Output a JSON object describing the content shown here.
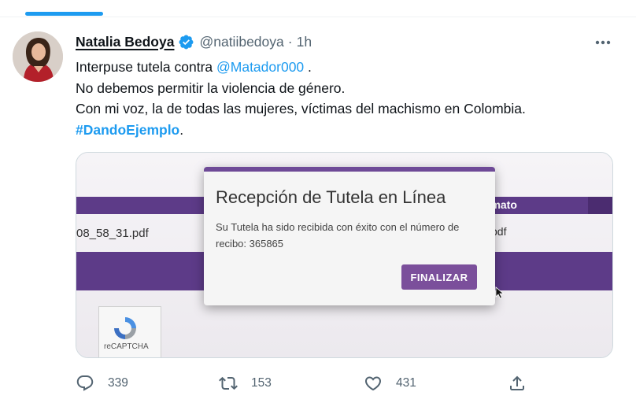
{
  "tweet": {
    "author": {
      "display_name": "Natalia Bedoya",
      "handle": "@natiibedoya",
      "separator": "·",
      "time": "1h",
      "verified": true
    },
    "text": {
      "line1_prefix": "Interpuse tutela contra ",
      "line1_mention": "@Matador000",
      "line1_suffix": " .",
      "line2": "No debemos permitir la violencia de género.",
      "line3": "Con mi voz, la de todas las mujeres, víctimas del machismo en Colombia.",
      "line4_hashtag": "#DandoEjemplo",
      "line4_suffix": "."
    },
    "media": {
      "dialog_title": "Recepción de Tutela en Línea",
      "dialog_body": "Su Tutela ha sido recibida con éxito con el número de recibo: 365865",
      "dialog_button": "FINALIZAR",
      "filename": "08_58_31.pdf",
      "column_header": "rmato",
      "column_value": "pdf",
      "captcha_label": "reCAPTCHA"
    },
    "actions": {
      "replies": "339",
      "retweets": "153",
      "likes": "431"
    }
  },
  "colors": {
    "accent": "#1d9bf0",
    "text_primary": "#0f1419",
    "text_secondary": "#536471",
    "form_purple": "#5d3b88"
  },
  "icons": {
    "verified": "verified-badge-icon",
    "more": "more-horizontal-icon",
    "reply": "reply-icon",
    "retweet": "retweet-icon",
    "like": "heart-icon",
    "share": "share-icon"
  }
}
